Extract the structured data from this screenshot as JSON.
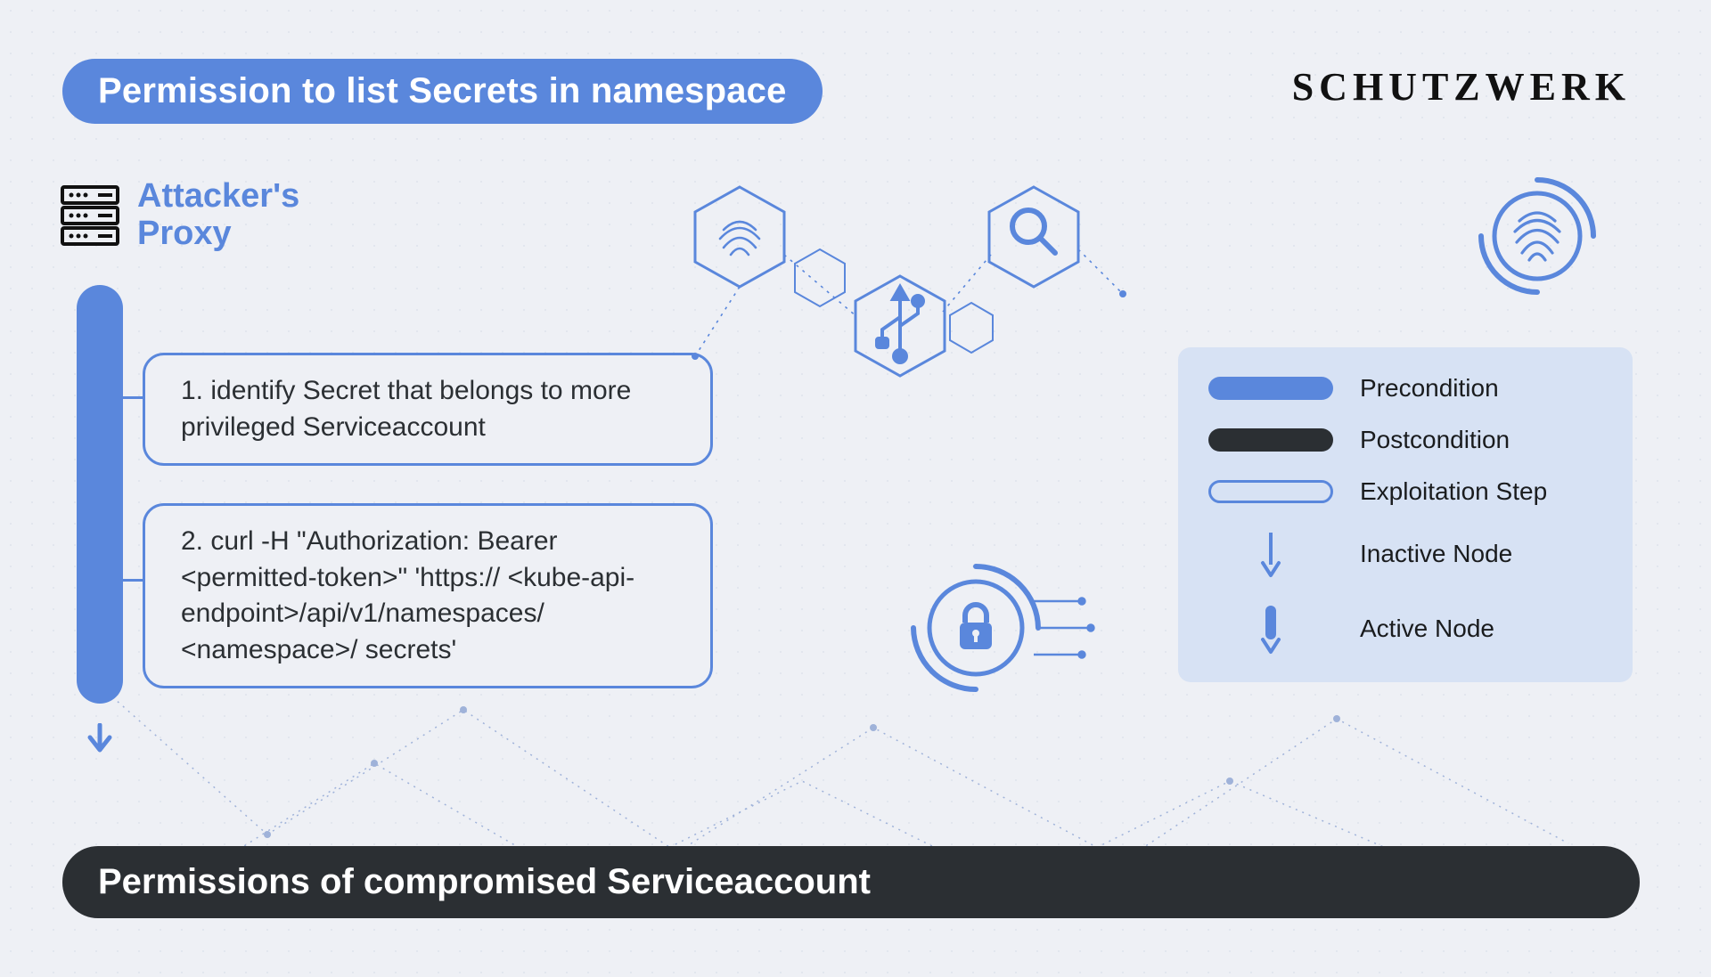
{
  "header": {
    "precondition_title": "Permission to list Secrets in namespace",
    "brand": "SCHUTZWERK"
  },
  "attacker": {
    "label_line1": "Attacker's",
    "label_line2": "Proxy"
  },
  "steps": [
    {
      "num": "1.",
      "text": "identify Secret that belongs to more privileged Serviceaccount"
    },
    {
      "num": "2.",
      "text": "curl -H \"Authorization: Bearer <permitted-token>\" 'https:// <kube-api-endpoint>/api/v1/namespaces/ <namespace>/ secrets'"
    }
  ],
  "postcondition": {
    "title": "Permissions of compromised Serviceaccount"
  },
  "legend": {
    "precondition": "Precondition",
    "postcondition": "Postcondition",
    "exploitation_step": "Exploitation Step",
    "inactive_node": "Inactive Node",
    "active_node": "Active Node"
  },
  "colors": {
    "accent": "#5a87dc",
    "dark": "#2b2f33",
    "panel": "#d7e2f4",
    "bg": "#eef0f5"
  }
}
